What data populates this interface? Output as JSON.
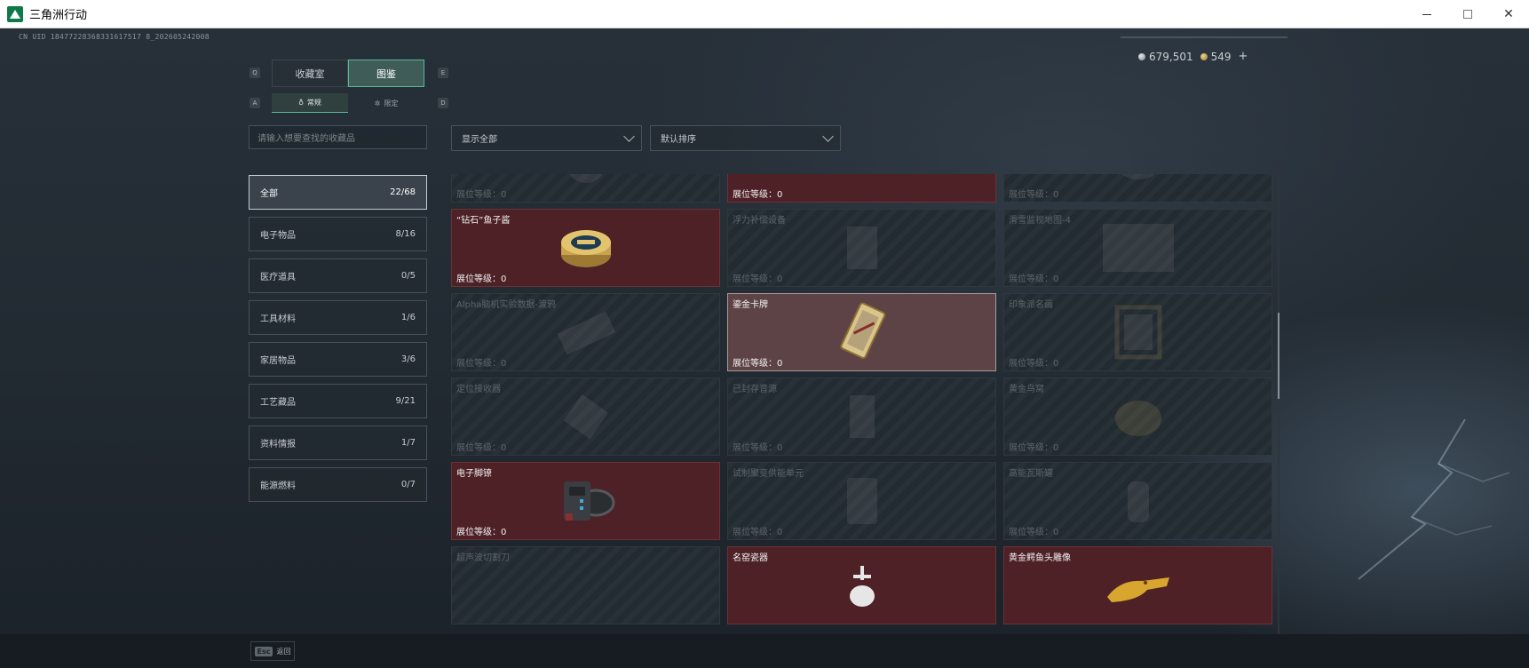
{
  "window": {
    "title": "三角洲行动",
    "min_label": "",
    "max_label": "",
    "close_label": "✕"
  },
  "header": {
    "uid": "CN UID 18477228368331617517 8_202605242008",
    "silver_amount": "679,501",
    "gold_amount": "549",
    "plus_label": "+"
  },
  "tabs": {
    "left_key": "Q",
    "right_key": "E",
    "items": [
      {
        "label": "收藏室"
      },
      {
        "label": "图鉴"
      }
    ]
  },
  "subtabs": {
    "left_key": "A",
    "right_key": "D",
    "items": [
      {
        "label": "常规"
      },
      {
        "label": "限定"
      }
    ]
  },
  "search": {
    "placeholder": "请输入想要查找的收藏品"
  },
  "categories": [
    {
      "label": "全部",
      "count": "22/68"
    },
    {
      "label": "电子物品",
      "count": "8/16"
    },
    {
      "label": "医疗道具",
      "count": "0/5"
    },
    {
      "label": "工具材料",
      "count": "1/6"
    },
    {
      "label": "家居物品",
      "count": "3/6"
    },
    {
      "label": "工艺藏品",
      "count": "9/21"
    },
    {
      "label": "资料情报",
      "count": "1/7"
    },
    {
      "label": "能源燃料",
      "count": "0/7"
    }
  ],
  "filters": {
    "show_label": "显示全部",
    "sort_label": "默认排序"
  },
  "cards": [
    {
      "name": "",
      "level": "展位等级：0"
    },
    {
      "name": "",
      "level": "展位等级：0"
    },
    {
      "name": "",
      "level": "展位等级：0"
    },
    {
      "name": "“钻石”鱼子酱",
      "level": "展位等级：0"
    },
    {
      "name": "浮力补偿设备",
      "level": "展位等级：0"
    },
    {
      "name": "滑雪监视地图-4",
      "level": "展位等级：0"
    },
    {
      "name": "Alpha脑机实验数据-渡鸦",
      "level": "展位等级：0"
    },
    {
      "name": "鎏金卡牌",
      "level": "展位等级：0"
    },
    {
      "name": "印象派名画",
      "level": "展位等级：0"
    },
    {
      "name": "定位接收器",
      "level": "展位等级：0"
    },
    {
      "name": "已封存音源",
      "level": "展位等级：0"
    },
    {
      "name": "黄金鸟窝",
      "level": "展位等级：0"
    },
    {
      "name": "电子脚镣",
      "level": "展位等级：0"
    },
    {
      "name": "试制聚变供能单元",
      "level": "展位等级：0"
    },
    {
      "name": "高能瓦斯罐",
      "level": "展位等级：0"
    },
    {
      "name": "超声波切割刀",
      "level": ""
    },
    {
      "name": "名窑瓷器",
      "level": ""
    },
    {
      "name": "黄金鳄鱼头雕像",
      "level": ""
    }
  ],
  "footer": {
    "esc_key": "Esc",
    "back_label": "返回"
  },
  "colors": {
    "accent": "#58b99a",
    "owned_card": "#4d2126",
    "selected_card": "#5e4346"
  }
}
